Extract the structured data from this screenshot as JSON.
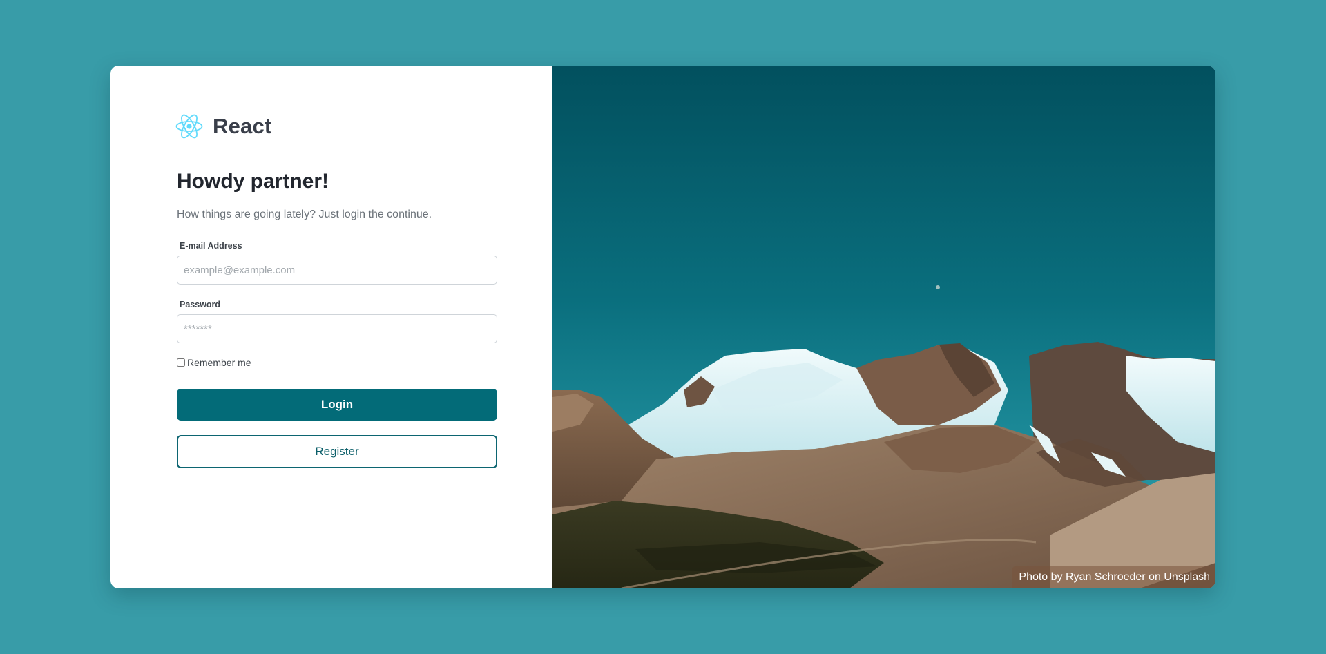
{
  "brand": {
    "name": "React",
    "logo_icon": "react-atom-icon",
    "logo_color": "#61dafb"
  },
  "login": {
    "heading": "Howdy partner!",
    "subtitle": "How things are going lately? Just login the continue.",
    "email": {
      "label": "E-mail Address",
      "placeholder": "example@example.com",
      "value": ""
    },
    "password": {
      "label": "Password",
      "placeholder": "*******",
      "value": ""
    },
    "remember": {
      "label": "Remember me",
      "checked": false
    },
    "login_button": "Login",
    "register_button": "Register"
  },
  "photo": {
    "credit": "Photo by Ryan Schroeder on Unsplash"
  },
  "colors": {
    "page_background": "#389ca8",
    "primary": "#036b78",
    "sky_top": "#02505e",
    "sky_bottom": "#1f8e9c"
  }
}
